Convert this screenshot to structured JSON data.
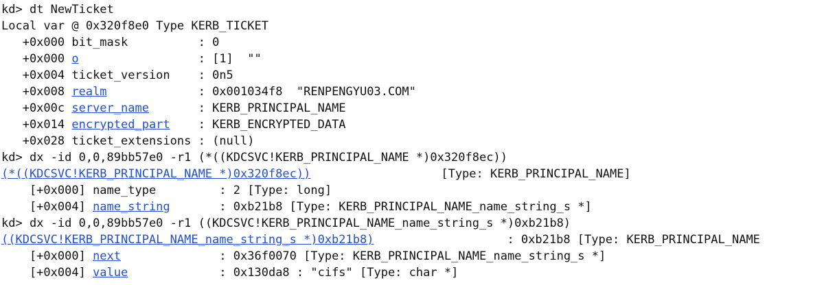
{
  "console": {
    "prompt": "kd> ",
    "cmd_dt": "dt NewTicket",
    "local_var": "Local var @ 0x320f8e0 Type KERB_TICKET",
    "fields": [
      {
        "prefix": "   +0x000 ",
        "name": "bit_mask",
        "link": false,
        "pad": "          ",
        "value": ": 0"
      },
      {
        "prefix": "   +0x000 ",
        "name": "o",
        "link": true,
        "pad": "                 ",
        "value": ": [1]  \"\""
      },
      {
        "prefix": "   +0x004 ",
        "name": "ticket_version",
        "link": false,
        "pad": "    ",
        "value": ": 0n5"
      },
      {
        "prefix": "   +0x008 ",
        "name": "realm",
        "link": true,
        "pad": "             ",
        "value": ": 0x001034f8  \"RENPENGYU03.COM\""
      },
      {
        "prefix": "   +0x00c ",
        "name": "server_name",
        "link": true,
        "pad": "       ",
        "value": ": KERB_PRINCIPAL_NAME"
      },
      {
        "prefix": "   +0x014 ",
        "name": "encrypted_part",
        "link": true,
        "pad": "    ",
        "value": ": KERB_ENCRYPTED_DATA"
      },
      {
        "prefix": "   +0x028 ",
        "name": "ticket_extensions",
        "link": false,
        "pad": " ",
        "value": ": (null)"
      }
    ],
    "cmd_dx1": "dx -id 0,0,89bb57e0 -r1 (*((KDCSVC!KERB_PRINCIPAL_NAME *)0x320f8ec))",
    "dx1_link": "(*((KDCSVC!KERB_PRINCIPAL_NAME *)0x320f8ec))",
    "dx1_type": "[Type: KERB_PRINCIPAL_NAME]",
    "dx1_rows": [
      {
        "prefix": "    [+0x000] ",
        "name": "name_type",
        "link": false,
        "pad": "         ",
        "value": ": 2 [Type: long]"
      },
      {
        "prefix": "    [+0x004] ",
        "name": "name_string",
        "link": true,
        "pad": "       ",
        "value": ": 0xb21b8 [Type: KERB_PRINCIPAL_NAME_name_string_s *]"
      }
    ],
    "cmd_dx2": "dx -id 0,0,89bb57e0 -r1 ((KDCSVC!KERB_PRINCIPAL_NAME_name_string_s *)0xb21b8)",
    "dx2_link": "((KDCSVC!KERB_PRINCIPAL_NAME_name_string_s *)0xb21b8)",
    "dx2_type": ": 0xb21b8 [Type: KERB_PRINCIPAL_NAME",
    "dx2_rows": [
      {
        "prefix": "    [+0x000] ",
        "name": "next",
        "link": true,
        "pad": "              ",
        "value": ": 0x36f0070 [Type: KERB_PRINCIPAL_NAME_name_string_s *]"
      },
      {
        "prefix": "    [+0x004] ",
        "name": "value",
        "link": true,
        "pad": "             ",
        "value": ": 0x130da8 : \"cifs\" [Type: char *]"
      }
    ]
  }
}
